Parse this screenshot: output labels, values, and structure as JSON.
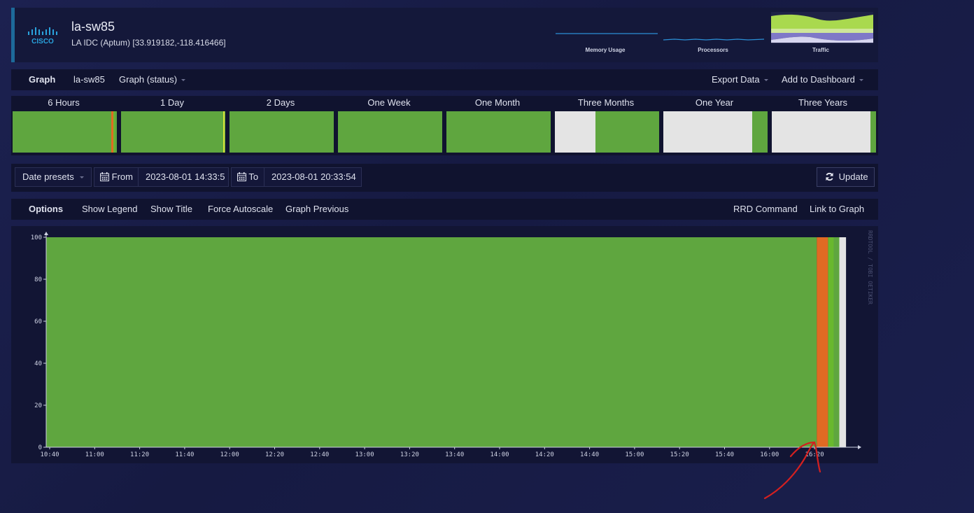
{
  "device": {
    "name": "la-sw85",
    "location": "LA IDC (Aptum) [33.919182,-118.416466]",
    "logo_text": "CISCO"
  },
  "mini_graphs": [
    {
      "label": "Memory Usage"
    },
    {
      "label": "Processors"
    },
    {
      "label": "Traffic"
    }
  ],
  "tabbar": {
    "active": "Graph",
    "device": "la-sw85",
    "graph_type": "Graph (status)",
    "export": "Export Data",
    "dashboard": "Add to Dashboard"
  },
  "periods": [
    {
      "label": "6 Hours"
    },
    {
      "label": "1 Day"
    },
    {
      "label": "2 Days"
    },
    {
      "label": "One Week"
    },
    {
      "label": "One Month"
    },
    {
      "label": "Three Months"
    },
    {
      "label": "One Year"
    },
    {
      "label": "Three Years"
    }
  ],
  "datebar": {
    "presets": "Date presets",
    "from_label": "From",
    "from_value": "2023-08-01 14:33:5",
    "to_label": "To",
    "to_value": "2023-08-01 20:33:54",
    "update": "Update"
  },
  "options": {
    "title": "Options",
    "show_legend": "Show Legend",
    "show_title": "Show Title",
    "force_autoscale": "Force Autoscale",
    "graph_previous": "Graph Previous",
    "rrd_command": "RRD Command",
    "link_to_graph": "Link to Graph"
  },
  "colors": {
    "up": "#5fa63f",
    "down": "#e06a23",
    "bright_green": "#69b82e",
    "empty": "#e4e4e4",
    "annotation": "#d42020"
  },
  "chart_data": {
    "type": "area",
    "yticks": [
      "0",
      "20",
      "40",
      "60",
      "80",
      "100"
    ],
    "ylim": [
      0,
      100
    ],
    "xticks": [
      "10:40",
      "11:00",
      "11:20",
      "11:40",
      "12:00",
      "12:20",
      "12:40",
      "13:00",
      "13:20",
      "13:40",
      "14:00",
      "14:20",
      "14:40",
      "15:00",
      "15:20",
      "15:40",
      "16:00",
      "16:20"
    ],
    "watermark": "RRDTOOL / TOBI OETIKER",
    "segments": [
      {
        "from": "10:38",
        "to": "16:21",
        "state": "up",
        "value": 100
      },
      {
        "from": "16:21",
        "to": "16:26",
        "state": "down",
        "value": 100
      },
      {
        "from": "16:26",
        "to": "16:31",
        "state": "up",
        "value": 100
      },
      {
        "from": "16:31",
        "to": "16:34",
        "state": "empty",
        "value": 100
      }
    ]
  }
}
